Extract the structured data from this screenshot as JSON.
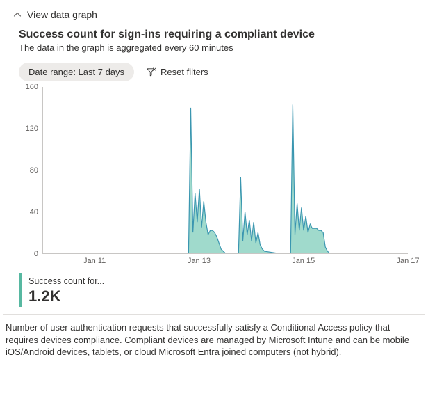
{
  "header": {
    "title": "View data graph"
  },
  "chart": {
    "title": "Success count for sign-ins requiring a compliant device",
    "subtitle": "The data in the graph is aggregated every 60 minutes"
  },
  "filters": {
    "date_range_label": "Date range: Last 7 days",
    "reset_label": "Reset filters"
  },
  "axes": {
    "y_ticks": [
      "0",
      "40",
      "80",
      "120",
      "160"
    ],
    "x_ticks": [
      "Jan 11",
      "Jan 13",
      "Jan 15",
      "Jan 17"
    ]
  },
  "summary": {
    "label": "Success count for...",
    "value": "1.2K"
  },
  "description": "Number of user authentication requests that successfully satisfy a Conditional Access policy that requires devices compliance. Compliant devices are managed by Microsoft Intune and can be mobile iOS/Android devices, tablets, or cloud Microsoft Entra joined computers (not hybrid).",
  "colors": {
    "series_line": "#3a96b0",
    "series_fill": "#8fd4c3",
    "accent": "#57b8a1"
  },
  "chart_data": {
    "type": "area",
    "title": "Success count for sign-ins requiring a compliant device",
    "xlabel": "",
    "ylabel": "",
    "ylim": [
      0,
      160
    ],
    "x_range": [
      "Jan 10",
      "Jan 17"
    ],
    "interval_minutes": 60,
    "series": [
      {
        "name": "Success count for...",
        "x": [
          "Jan 10 00:00",
          "Jan 10 12:00",
          "Jan 11 00:00",
          "Jan 11 12:00",
          "Jan 12 00:00",
          "Jan 12 12:00",
          "Jan 12 18:00",
          "Jan 12 19:00",
          "Jan 12 20:00",
          "Jan 12 21:00",
          "Jan 12 22:00",
          "Jan 12 23:00",
          "Jan 13 00:00",
          "Jan 13 01:00",
          "Jan 13 02:00",
          "Jan 13 03:00",
          "Jan 13 04:00",
          "Jan 13 05:00",
          "Jan 13 06:00",
          "Jan 13 07:00",
          "Jan 13 08:00",
          "Jan 13 09:00",
          "Jan 13 10:00",
          "Jan 13 11:00",
          "Jan 13 12:00",
          "Jan 13 18:00",
          "Jan 13 19:00",
          "Jan 13 20:00",
          "Jan 13 21:00",
          "Jan 13 22:00",
          "Jan 13 23:00",
          "Jan 14 00:00",
          "Jan 14 01:00",
          "Jan 14 02:00",
          "Jan 14 03:00",
          "Jan 14 04:00",
          "Jan 14 05:00",
          "Jan 14 06:00",
          "Jan 14 12:00",
          "Jan 14 18:00",
          "Jan 14 19:00",
          "Jan 14 20:00",
          "Jan 14 21:00",
          "Jan 14 22:00",
          "Jan 14 23:00",
          "Jan 15 00:00",
          "Jan 15 01:00",
          "Jan 15 02:00",
          "Jan 15 03:00",
          "Jan 15 04:00",
          "Jan 15 05:00",
          "Jan 15 06:00",
          "Jan 15 07:00",
          "Jan 15 08:00",
          "Jan 15 09:00",
          "Jan 15 10:00",
          "Jan 15 11:00",
          "Jan 15 12:00",
          "Jan 16 00:00",
          "Jan 16 12:00",
          "Jan 17 00:00"
        ],
        "values": [
          0,
          0,
          0,
          0,
          0,
          0,
          0,
          0,
          140,
          20,
          58,
          30,
          62,
          25,
          50,
          30,
          18,
          22,
          22,
          20,
          16,
          10,
          4,
          2,
          0,
          0,
          73,
          12,
          40,
          18,
          32,
          12,
          30,
          10,
          20,
          8,
          4,
          2,
          0,
          0,
          143,
          18,
          48,
          22,
          44,
          22,
          36,
          20,
          28,
          24,
          24,
          24,
          22,
          22,
          20,
          6,
          2,
          0,
          0,
          0,
          0
        ]
      }
    ]
  }
}
